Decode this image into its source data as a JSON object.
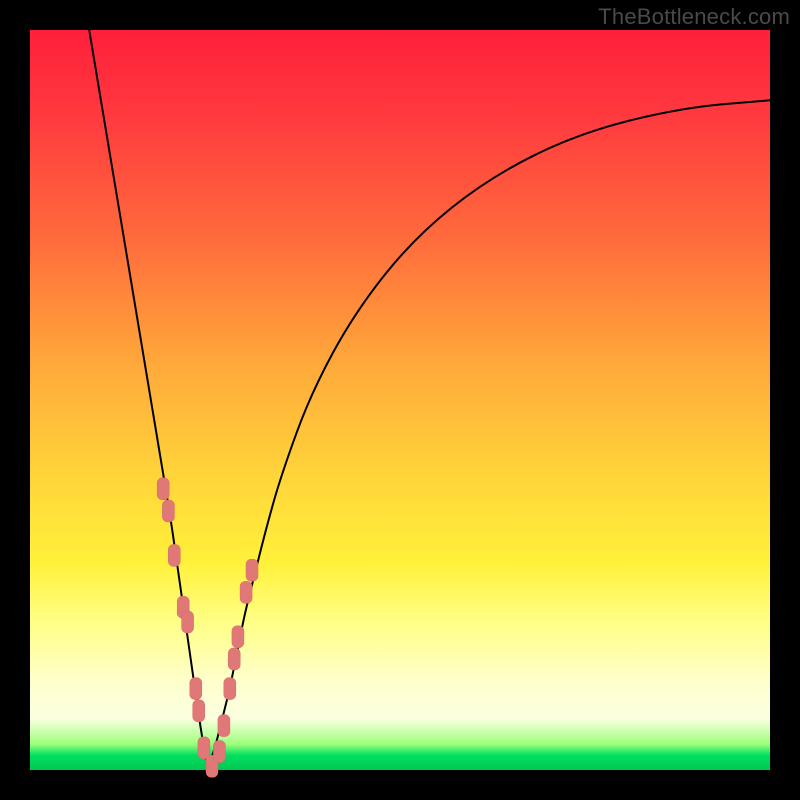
{
  "watermark": "TheBottleneck.com",
  "colors": {
    "frame": "#000000",
    "curve": "#000000",
    "marker_fill": "#e07878",
    "marker_stroke": "#d86868",
    "gradient_stops": [
      "#ff1f3a",
      "#ff3b3f",
      "#ff6a3c",
      "#ffa83a",
      "#ffd43a",
      "#fff13a",
      "#ffff86",
      "#ffffcc",
      "#fcffe0",
      "#9cff7a",
      "#00e060",
      "#00c850"
    ]
  },
  "chart_data": {
    "type": "line",
    "title": "",
    "xlabel": "",
    "ylabel": "",
    "xlim": [
      0,
      100
    ],
    "ylim": [
      0,
      100
    ],
    "note": "Axes unlabeled/hidden in source image; x and y are nominal 0–100. Curve is a V-shaped bottleneck profile with minimum near x≈24. Background is a red→green vertical gradient (bottleneck severity heat).",
    "series": [
      {
        "name": "bottleneck-curve",
        "x": [
          8,
          10,
          12,
          14,
          16,
          18,
          19,
          20,
          21,
          22,
          23,
          24,
          25,
          26,
          27,
          28,
          29,
          30,
          32,
          34,
          38,
          44,
          52,
          62,
          74,
          88,
          100
        ],
        "y": [
          100,
          88,
          76,
          64,
          52,
          40,
          34,
          27,
          20,
          13,
          6,
          0,
          3,
          7,
          11,
          16,
          21,
          25,
          33,
          40,
          51,
          62,
          72,
          80,
          86,
          89.5,
          90.5
        ]
      }
    ],
    "markers": {
      "name": "highlight-points",
      "shape": "rounded-rect",
      "x": [
        18.0,
        18.7,
        19.5,
        20.7,
        21.3,
        22.4,
        22.8,
        23.5,
        24.6,
        25.6,
        26.2,
        27.0,
        27.6,
        28.1,
        29.2,
        30.0
      ],
      "y": [
        38,
        35,
        29,
        22,
        20,
        11,
        8,
        3,
        0.5,
        2.5,
        6,
        11,
        15,
        18,
        24,
        27
      ]
    }
  }
}
